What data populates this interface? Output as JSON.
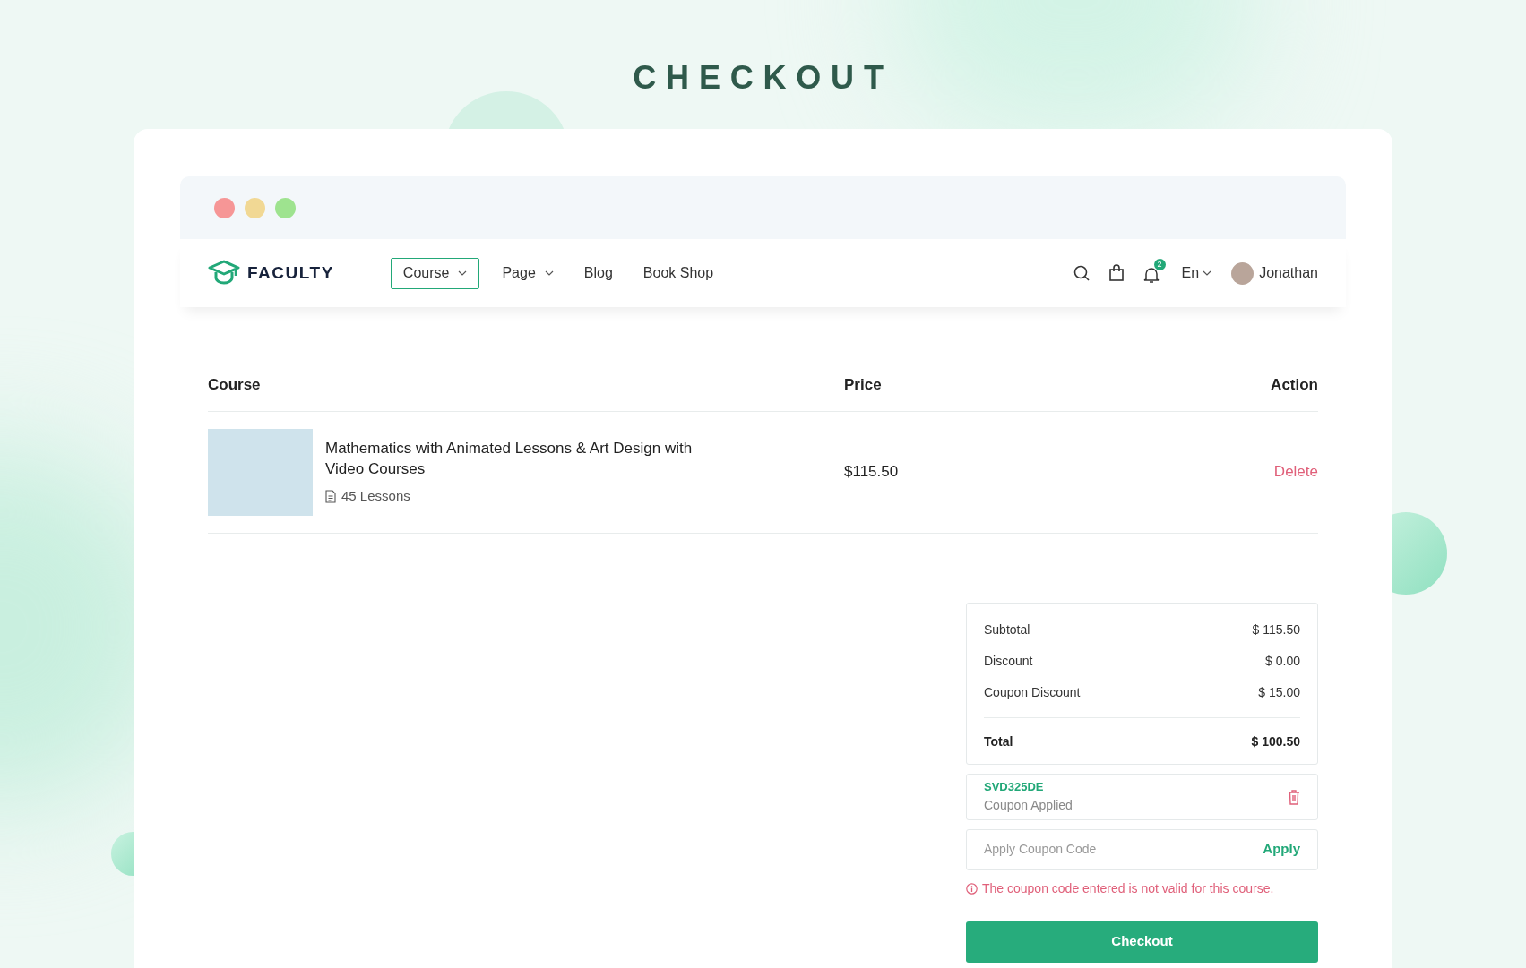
{
  "page_title": "CHECKOUT",
  "nav": {
    "brand": "FACULTY",
    "items": [
      {
        "label": "Course",
        "kind": "dropdown",
        "selected": true
      },
      {
        "label": "Page",
        "kind": "dropdown",
        "selected": false
      },
      {
        "label": "Blog",
        "kind": "link",
        "selected": false
      },
      {
        "label": "Book Shop",
        "kind": "link",
        "selected": false
      }
    ],
    "notification_count": "2",
    "language": "En",
    "user": "Jonathan"
  },
  "table": {
    "columns": [
      "Course",
      "Price",
      "Action"
    ],
    "rows": [
      {
        "title": "Mathematics with Animated Lessons & Art Design with Video Courses",
        "lessons": "45 Lessons",
        "price": "$115.50",
        "action": "Delete"
      }
    ]
  },
  "summary": {
    "lines": [
      {
        "kind": "line",
        "label": "Subtotal",
        "value": "$ 115.50"
      },
      {
        "kind": "line",
        "label": "Discount",
        "value": "$ 0.00"
      },
      {
        "kind": "line",
        "label": "Coupon Discount",
        "value": "$ 15.00"
      },
      {
        "kind": "total",
        "label": "Total",
        "value": "$ 100.50"
      }
    ]
  },
  "coupon": {
    "code": "SVD325DE",
    "status": "Coupon Applied"
  },
  "coupon_field": {
    "placeholder": "Apply Coupon Code",
    "button": "Apply"
  },
  "error": "The coupon code entered is not valid for this course.",
  "checkout_button": "Checkout"
}
